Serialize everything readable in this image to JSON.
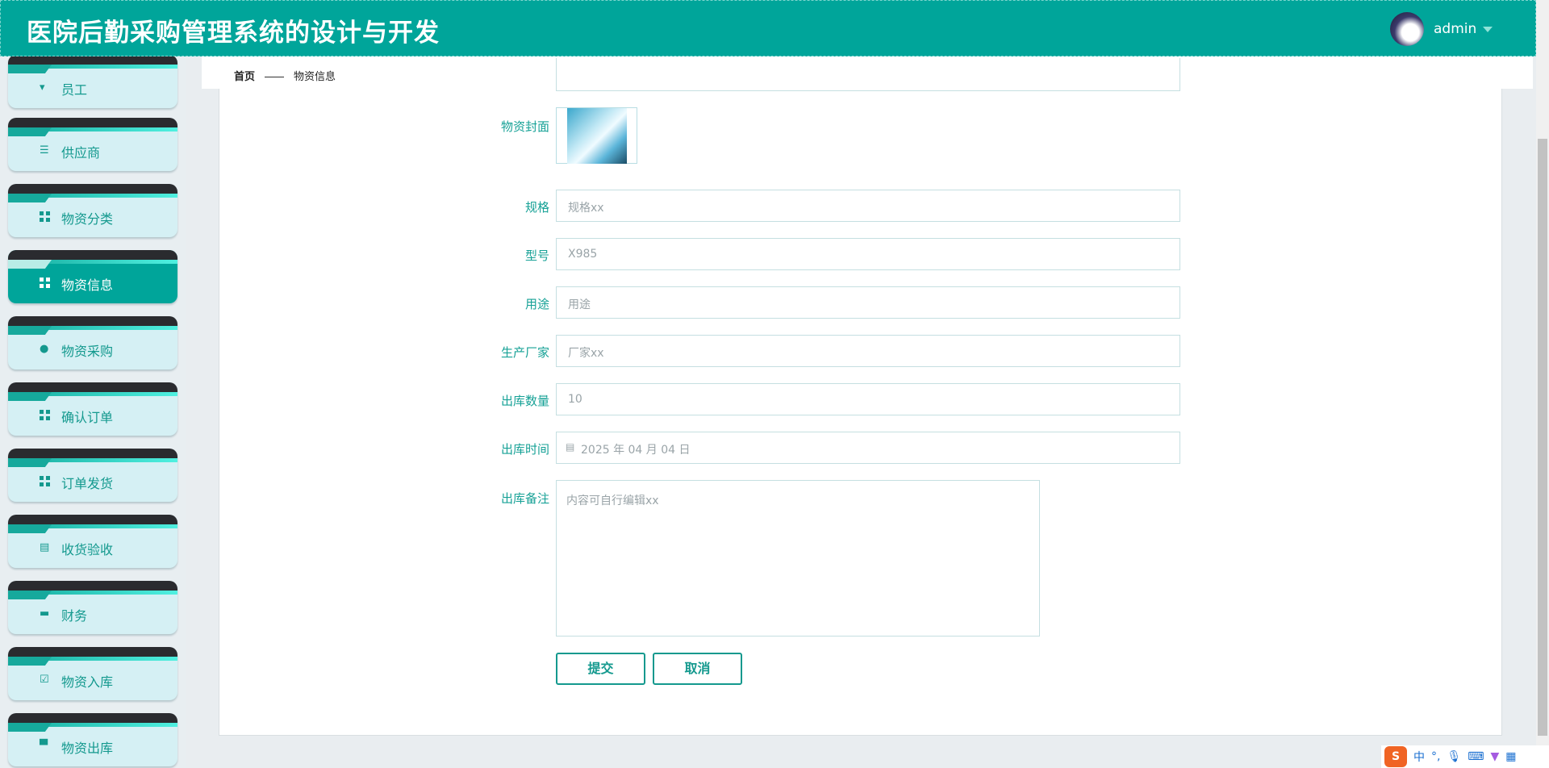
{
  "header": {
    "title": "医院后勤采购管理系统的设计与开发",
    "user": "admin"
  },
  "sidebar": {
    "items": [
      {
        "label": "员工",
        "icon": "user-icon"
      },
      {
        "label": "供应商",
        "icon": "list-icon"
      },
      {
        "label": "物资分类",
        "icon": "grid-icon"
      },
      {
        "label": "物资信息",
        "icon": "grid-icon",
        "active": true
      },
      {
        "label": "物资采购",
        "icon": "bulb-icon"
      },
      {
        "label": "确认订单",
        "icon": "grid-icon"
      },
      {
        "label": "订单发货",
        "icon": "grid-icon"
      },
      {
        "label": "收货验收",
        "icon": "clipboard-icon"
      },
      {
        "label": "财务",
        "icon": "ticket-icon"
      },
      {
        "label": "物资入库",
        "icon": "clipboard-check-icon"
      },
      {
        "label": "物资出库",
        "icon": "printer-icon"
      }
    ]
  },
  "breadcrumb": {
    "home": "首页",
    "current": "物资信息"
  },
  "form": {
    "cover_label": "物资封面",
    "fields": [
      {
        "label": "规格",
        "value": "规格xx"
      },
      {
        "label": "型号",
        "value": "X985"
      },
      {
        "label": "用途",
        "value": "用途"
      },
      {
        "label": "生产厂家",
        "value": "厂家xx"
      },
      {
        "label": "出库数量",
        "value": "10"
      },
      {
        "label": "出库时间",
        "value": "2025 年 04 月 04 日"
      }
    ],
    "remark_label": "出库备注",
    "remark_value": "内容可自行编辑xx",
    "submit": "提交",
    "cancel": "取消"
  },
  "ime": {
    "s": "S",
    "lang": "中",
    "punct": "°,"
  },
  "colors": {
    "primary": "#00a59a",
    "sidebar_bg": "#d5f0f4"
  }
}
